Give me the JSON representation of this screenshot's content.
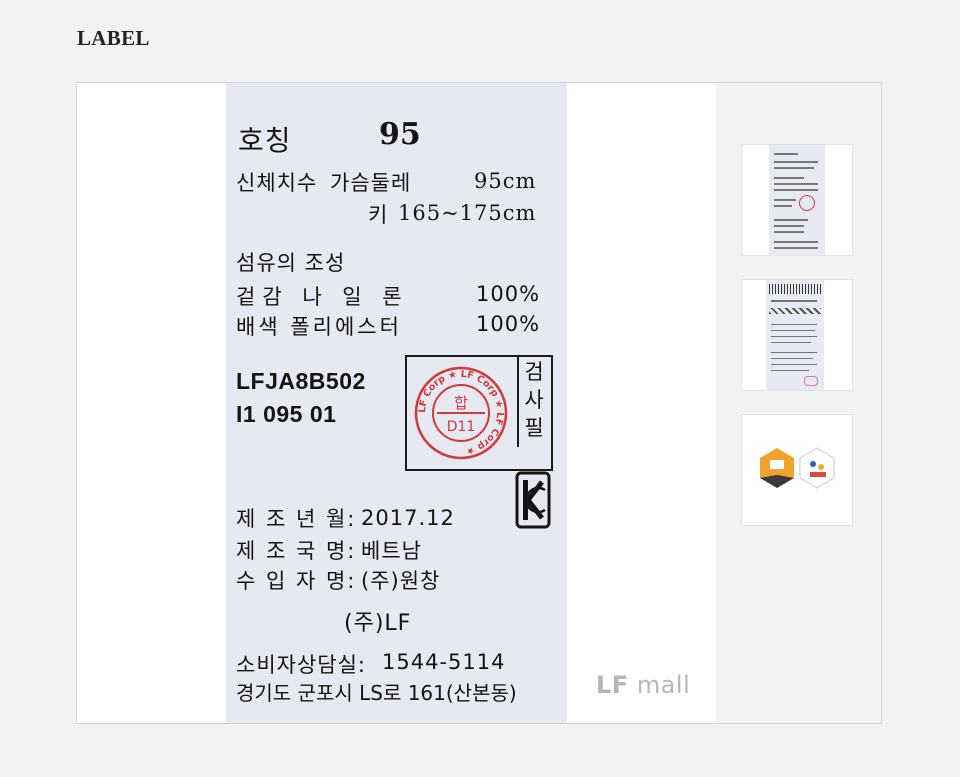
{
  "section": {
    "title": "LABEL"
  },
  "care_label": {
    "size_label": "호칭",
    "size_value": "95",
    "body_size_label": "신체치수",
    "chest_label": "가슴둘레",
    "chest_value": "95cm",
    "height_label": "키",
    "height_value": "165~175cm",
    "fiber_title": "섬유의 조성",
    "outer_label": "겉감 나 일 론",
    "outer_value": "100%",
    "trim_label": "배색 폴리에스터",
    "trim_value": "100%",
    "style_code": "LFJA8B502",
    "style_sub": "I1 095 01",
    "inspect_chars": [
      "검",
      "사",
      "필"
    ],
    "stamp_center_top": "합",
    "stamp_center_bottom": "D11",
    "stamp_ring_text": "LF Corp ★ LF Corp ★ LF Corp ★",
    "mfg_date_label": "제 조 년 월:",
    "mfg_date_value": "2017.12",
    "origin_label": "제 조 국 명:",
    "origin_value": "베트남",
    "importer_label": "수 입 자 명:",
    "importer_value": "(주)원창",
    "company": "(주)LF",
    "cs_label": "소비자상담실:",
    "cs_phone": "1544-5114",
    "address": "경기도 군포시 LS로 161(산본동)",
    "kc_mark": "KC"
  },
  "watermark": {
    "brand": "LF",
    "suffix": "mall"
  },
  "thumbnails": [
    {
      "name": "label-front"
    },
    {
      "name": "label-back"
    },
    {
      "name": "certification-badges"
    }
  ],
  "colors": {
    "page_bg": "#f2f2f2",
    "label_fabric": "#e6e9f1",
    "stamp_red": "#d23a3a",
    "badge_orange": "#f0a22a"
  }
}
